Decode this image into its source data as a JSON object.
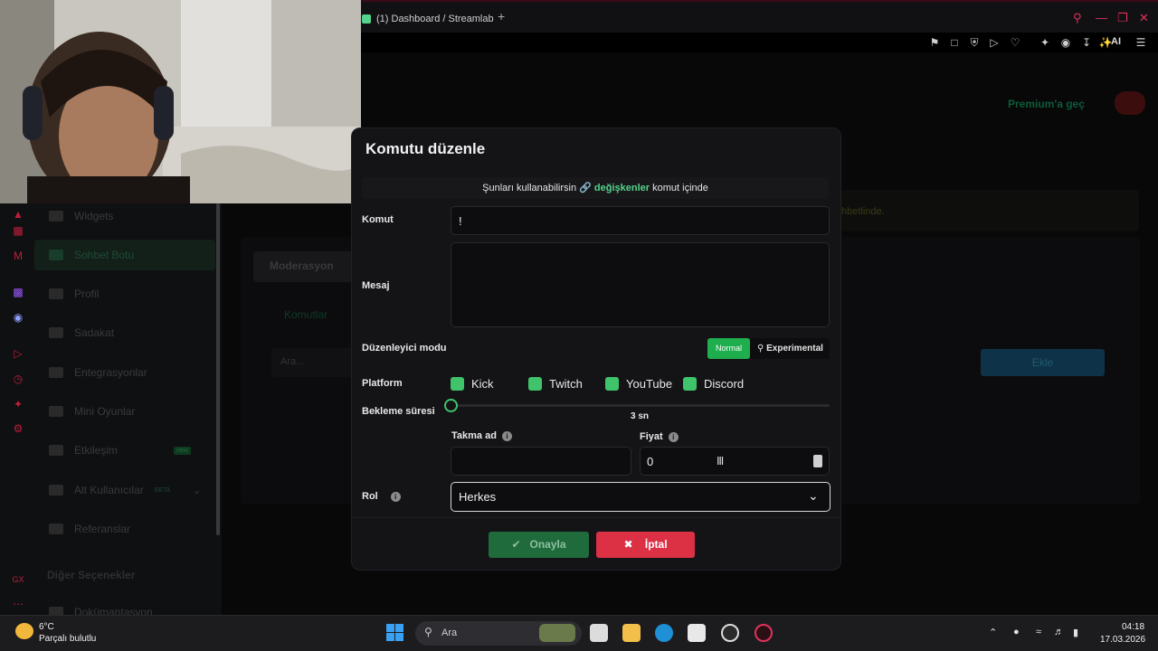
{
  "browser": {
    "tab_title": "(1) Dashboard / Streamlab",
    "new_tab": "+",
    "ai_label": "AI"
  },
  "page": {
    "premium_label": "Premium'a geç",
    "notice_fragment": "hbetlinde.",
    "bg_tab": "Moderasyon",
    "bg_subtab": "Komutlar",
    "bg_search": "Ara...",
    "bg_add": "Ekle"
  },
  "sidebar": {
    "items": [
      {
        "label": "Widgets"
      },
      {
        "label": "Sohbet Botu"
      },
      {
        "label": "Profil"
      },
      {
        "label": "Sadakat"
      },
      {
        "label": "Entegrasyonlar"
      },
      {
        "label": "Mini Oyunlar"
      },
      {
        "label": "Etkileşim"
      },
      {
        "label": "Alt Kullanıcılar"
      },
      {
        "label": "Referanslar"
      },
      {
        "label": "Dokümantasyon"
      }
    ],
    "badge_new": "new",
    "badge_beta": "BETA",
    "section_other": "Diğer Seçenekler"
  },
  "modal": {
    "title": "Komutu düzenle",
    "info_prefix": "Şunları kullanabilirsin",
    "info_link": "değişkenler",
    "info_suffix": "komut içinde",
    "komut_label": "Komut",
    "komut_value": "!",
    "mesaj_label": "Mesaj",
    "mesaj_value": "",
    "editor_label": "Düzenleyici modu",
    "mode_normal": "Normal",
    "mode_experimental": "Experimental",
    "platform_label": "Platform",
    "platforms": [
      {
        "label": "Kick",
        "checked": true
      },
      {
        "label": "Twitch",
        "checked": true
      },
      {
        "label": "YouTube",
        "checked": true
      },
      {
        "label": "Discord",
        "checked": true
      }
    ],
    "cooldown_label": "Bekleme süresi",
    "cooldown_value_text": "3 sn",
    "cooldown_fraction": 0,
    "alias_label": "Takma ad",
    "alias_value": "",
    "price_label": "Fiyat",
    "price_value": "0",
    "role_label": "Rol",
    "role_value": "Herkes",
    "confirm_label": "Onayla",
    "cancel_label": "İptal"
  },
  "taskbar": {
    "weather_temp": "6°C",
    "weather_desc": "Parçalı bulutlu",
    "search_placeholder": "Ara",
    "time": "04:18",
    "date": "17.03.2026"
  },
  "colors": {
    "accent_green": "#3fc46b",
    "cancel_red": "#dc3045",
    "window_controls": "#e0325a"
  }
}
